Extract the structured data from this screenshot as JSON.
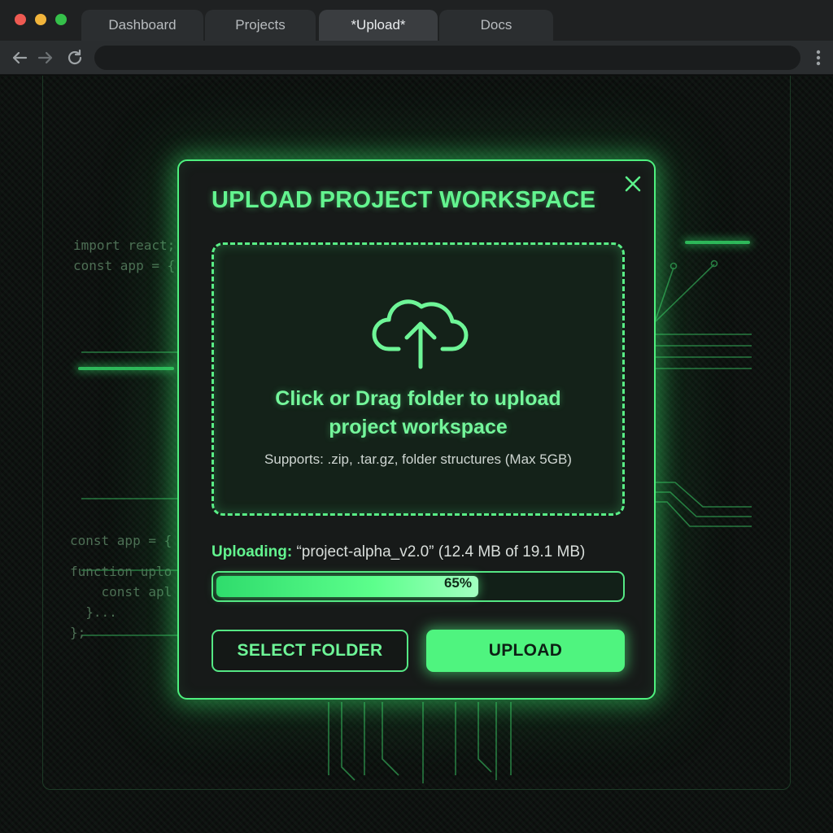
{
  "browser": {
    "tabs": [
      {
        "label": "Dashboard",
        "active": false
      },
      {
        "label": "Projects",
        "active": false
      },
      {
        "label": "*Upload*",
        "active": true
      },
      {
        "label": "Docs",
        "active": false
      }
    ],
    "address": "",
    "icons": {
      "back": "arrow-left-icon",
      "forward": "arrow-right-icon",
      "reload": "reload-icon",
      "menu": "kebab-menu-icon"
    }
  },
  "background": {
    "code_left_top": [
      "import react;",
      "const app = {"
    ],
    "code_left_bottom": [
      "const app = {",
      "function uplo",
      "    const apl",
      "  }...",
      "};"
    ]
  },
  "modal": {
    "title": "UPLOAD PROJECT WORKSPACE",
    "close_icon": "close-icon",
    "dropzone": {
      "icon": "cloud-upload-icon",
      "title_line1": "Click or Drag folder to upload",
      "title_line2": "project workspace",
      "subtitle": "Supports: .zip, .tar.gz, folder structures (Max 5GB)"
    },
    "status": {
      "label": "Uploading:",
      "filename": "“project-alpha_v2.0”",
      "progress_text": "(12.4 MB of 19.1 MB)"
    },
    "progress": {
      "percent": 65,
      "percent_label": "65%"
    },
    "buttons": {
      "select_label": "SELECT FOLDER",
      "upload_label": "UPLOAD"
    }
  },
  "colors": {
    "accent": "#4ef07e",
    "accent_text": "#63f48f",
    "modal_bg": "#171a19",
    "page_bg": "#0b0d0c"
  }
}
